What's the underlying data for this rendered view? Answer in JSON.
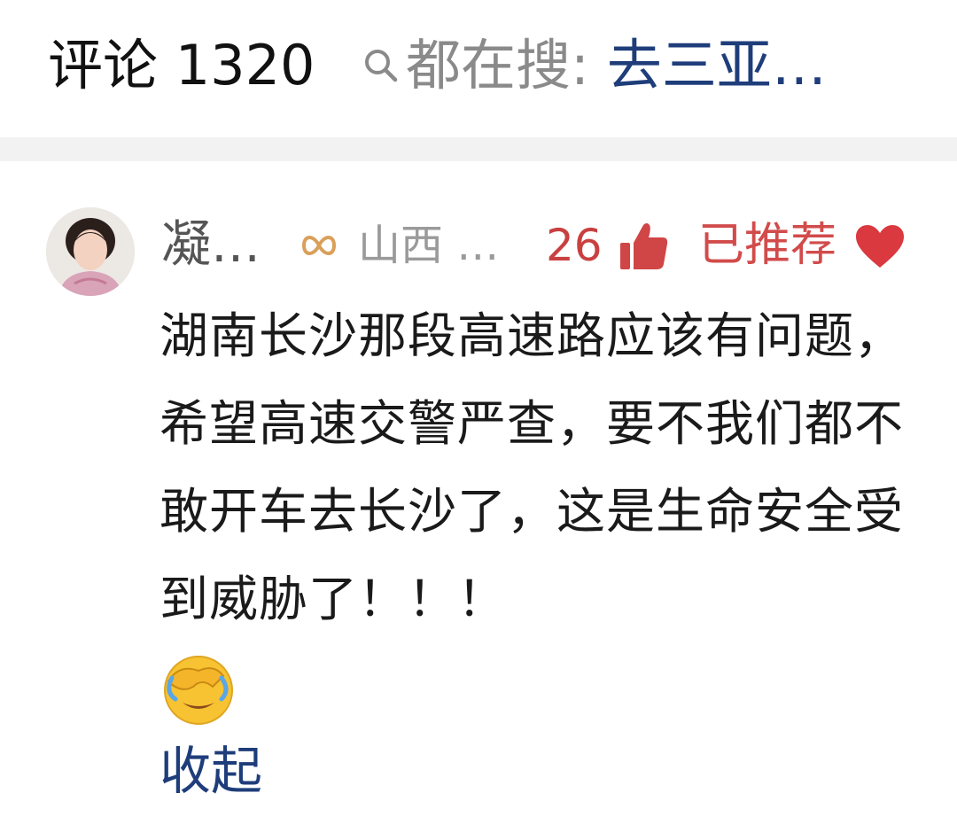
{
  "header": {
    "comment_count_label": "评论 1320",
    "search_prefix": "都在搜:",
    "search_term": "去三亚…",
    "search_icon": "search-icon"
  },
  "comment": {
    "username": "凝…",
    "badge_icon": "infinity-badge-icon",
    "location": "山西 …",
    "like_count": "26",
    "like_icon": "thumbs-up-icon",
    "recommended_label": "已推荐",
    "recommended_icon": "heart-icon",
    "text": "湖南长沙那段高速路应该有问题，希望高速交警严查，要不我们都不敢开车去长沙了，这是生命安全受到威胁了！！！",
    "emoji": "facepalm-emoji",
    "collapse_label": "收起"
  },
  "colors": {
    "accent_blue": "#1e3d7a",
    "like_red": "#c94040",
    "recommended_red": "#d24b4b",
    "muted_gray": "#8a8a8a",
    "badge_orange": "#d9a05a"
  }
}
